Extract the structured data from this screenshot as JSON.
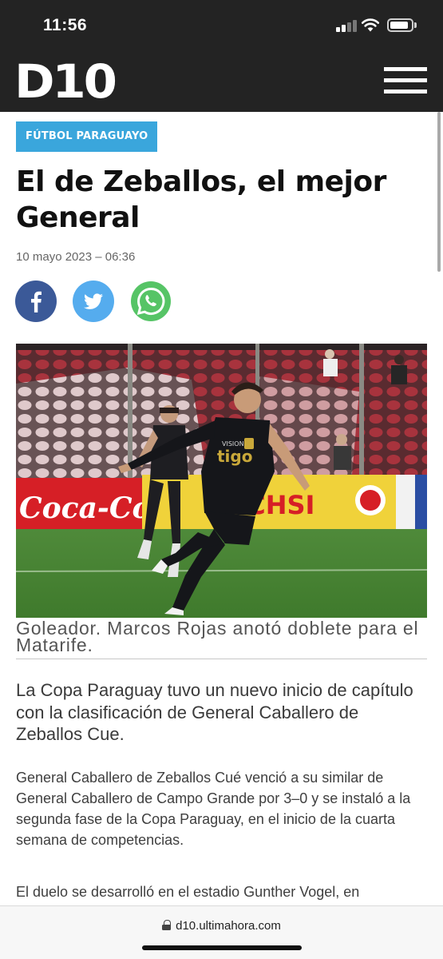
{
  "status_bar": {
    "time": "11:56"
  },
  "header": {
    "logo": "D10",
    "menu_icon": "hamburger-menu-icon"
  },
  "article": {
    "category": "FÚTBOL PARAGUAYO",
    "headline": "El de Zeballos, el mejor General",
    "date": "10 mayo 2023 – 06:36",
    "share": {
      "facebook_icon": "facebook-icon",
      "twitter_icon": "twitter-icon",
      "whatsapp_icon": "whatsapp-icon"
    },
    "photo": {
      "banners": [
        "Coca-Cola",
        "OCHSI"
      ],
      "jersey_text": [
        "VISION",
        "tigo"
      ]
    },
    "caption": "Goleador. Marcos Rojas anotó  doblete para el Matarife.",
    "lead": "La Copa Paraguay tuvo un nuevo inicio de capítulo con la clasificación de General Caballero de Zeballos Cue.",
    "paragraphs": [
      "General Caballero de Zeballos Cué venció a su similar de General Caballero de Campo Grande por 3–0 y se instaló a la segunda fase de la Copa Paraguay, en el inicio de la cuarta semana de competencias.",
      "El duelo se desarrolló en el estadio Gunther Vogel, en"
    ]
  },
  "browser": {
    "url": "d10.ultimahora.com"
  },
  "colors": {
    "header_bg": "#232323",
    "category_bg": "#3aa6dc",
    "facebook": "#3b5998",
    "twitter": "#55acee",
    "whatsapp": "#4fc35a"
  }
}
